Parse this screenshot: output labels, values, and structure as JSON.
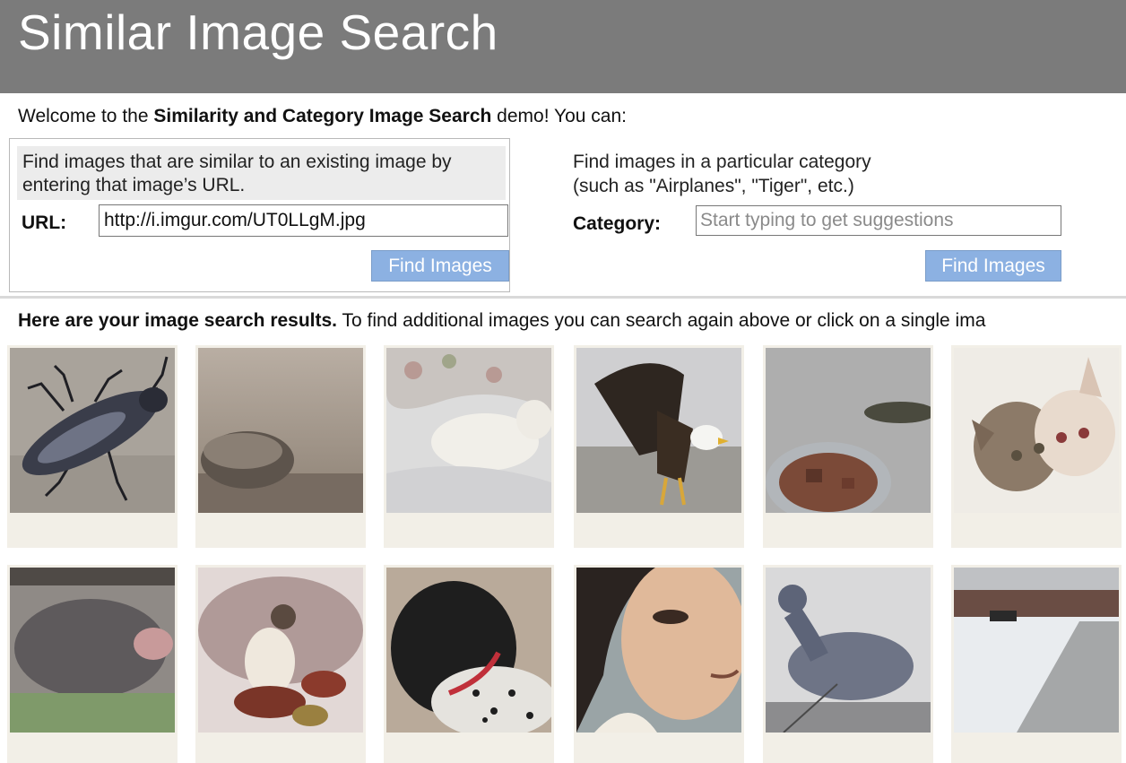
{
  "header": {
    "title": "Similar Image Search"
  },
  "welcome": {
    "prefix": "Welcome to the ",
    "bold": "Similarity and Category Image Search",
    "suffix": " demo! You can:"
  },
  "url_search": {
    "description": "Find images that are similar to an existing image by entering that image’s URL.",
    "label": "URL:",
    "value": "http://i.imgur.com/UT0LLgM.jpg",
    "button_label": "Find Images"
  },
  "category_search": {
    "description_line1": "Find images in a particular category",
    "description_line2": "(such as \"Airplanes\", \"Tiger\", etc.)",
    "label": "Category:",
    "placeholder": "Start typing to get suggestions",
    "value": "",
    "button_label": "Find Images"
  },
  "results": {
    "bold": "Here are your image search results.",
    "text": " To find additional images you can search again above or click on a single ima"
  },
  "images": [
    {
      "subject": "beetle"
    },
    {
      "subject": "pebble"
    },
    {
      "subject": "white-cat-on-blanket"
    },
    {
      "subject": "bald-eagle"
    },
    {
      "subject": "lizard-and-foil-tray"
    },
    {
      "subject": "two-kittens"
    },
    {
      "subject": "pig"
    },
    {
      "subject": "siamese-cat-on-rocks"
    },
    {
      "subject": "spotted-dog"
    },
    {
      "subject": "painted-portrait"
    },
    {
      "subject": "pigeon"
    },
    {
      "subject": "snowy-street"
    }
  ]
}
